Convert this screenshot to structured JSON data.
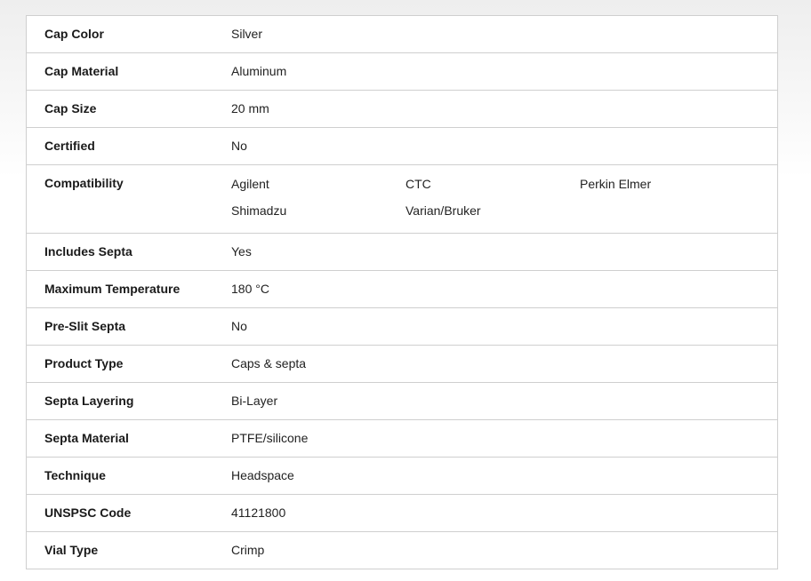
{
  "specs": {
    "rows": [
      {
        "label": "Cap Color",
        "value": "Silver"
      },
      {
        "label": "Cap Material",
        "value": "Aluminum"
      },
      {
        "label": "Cap Size",
        "value": "20 mm"
      },
      {
        "label": "Certified",
        "value": "No"
      },
      {
        "label": "Compatibility",
        "values": [
          "Agilent",
          "CTC",
          "Perkin Elmer",
          "Shimadzu",
          "Varian/Bruker"
        ]
      },
      {
        "label": "Includes Septa",
        "value": "Yes"
      },
      {
        "label": "Maximum Temperature",
        "value": "180 °C"
      },
      {
        "label": "Pre-Slit Septa",
        "value": "No"
      },
      {
        "label": "Product Type",
        "value": "Caps & septa"
      },
      {
        "label": "Septa Layering",
        "value": "Bi-Layer"
      },
      {
        "label": "Septa Material",
        "value": "PTFE/silicone"
      },
      {
        "label": "Technique",
        "value": "Headspace"
      },
      {
        "label": "UNSPSC Code",
        "value": "41121800"
      },
      {
        "label": "Vial Type",
        "value": "Crimp"
      }
    ]
  }
}
